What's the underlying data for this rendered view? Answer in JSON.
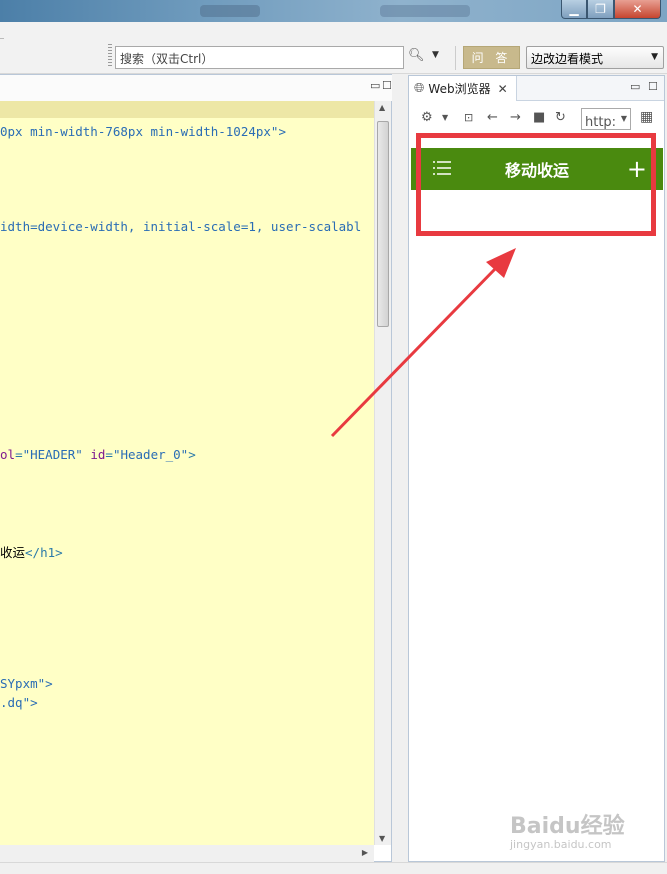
{
  "window": {
    "controls": {
      "minimize": "▁",
      "maximize": "❐",
      "close": "✕"
    }
  },
  "toolbar": {
    "search_placeholder": "搜索（双击Ctrl）",
    "search_icon": "search-icon",
    "ask_label": "问 答",
    "mode_selected": "边改边看模式"
  },
  "editor": {
    "lines": [
      {
        "row": 0,
        "parts": [
          {
            "t": "0px min-width-768px min-width-1024px\">",
            "c": "val"
          }
        ]
      },
      {
        "row": 1,
        "parts": [
          {
            "t": "idth=device-width, initial-scale=1, user-scalabl",
            "c": "val"
          }
        ]
      },
      {
        "row": 2,
        "parts": [
          {
            "t": "ol",
            "c": "attr"
          },
          {
            "t": "=",
            "c": "tag"
          },
          {
            "t": "\"HEADER\"",
            "c": "val"
          },
          {
            "t": " ",
            "c": "tag"
          },
          {
            "t": "id",
            "c": "attr"
          },
          {
            "t": "=",
            "c": "tag"
          },
          {
            "t": "\"Header_0\"",
            "c": "val"
          },
          {
            "t": ">",
            "c": "tag"
          }
        ]
      },
      {
        "row": 3,
        "parts": [
          {
            "t": "收运",
            "c": "text"
          },
          {
            "t": "</h1>",
            "c": "tag"
          }
        ]
      },
      {
        "row": 4,
        "parts": [
          {
            "t": "SYpxm\">",
            "c": "val"
          }
        ]
      },
      {
        "row": 5,
        "parts": [
          {
            "t": ".dq\">",
            "c": "val"
          }
        ]
      }
    ]
  },
  "browser": {
    "tab_label": "Web浏览器",
    "url_value": "http:",
    "app_title": "移动收运"
  },
  "watermark": {
    "brand": "Baidu经验",
    "sub": "jingyan.baidu.com"
  },
  "colors": {
    "app_header": "#4a8a0f",
    "highlight": "#e83a40",
    "ask_button": "#c8b98c",
    "editor_bg": "#ffffc6"
  }
}
